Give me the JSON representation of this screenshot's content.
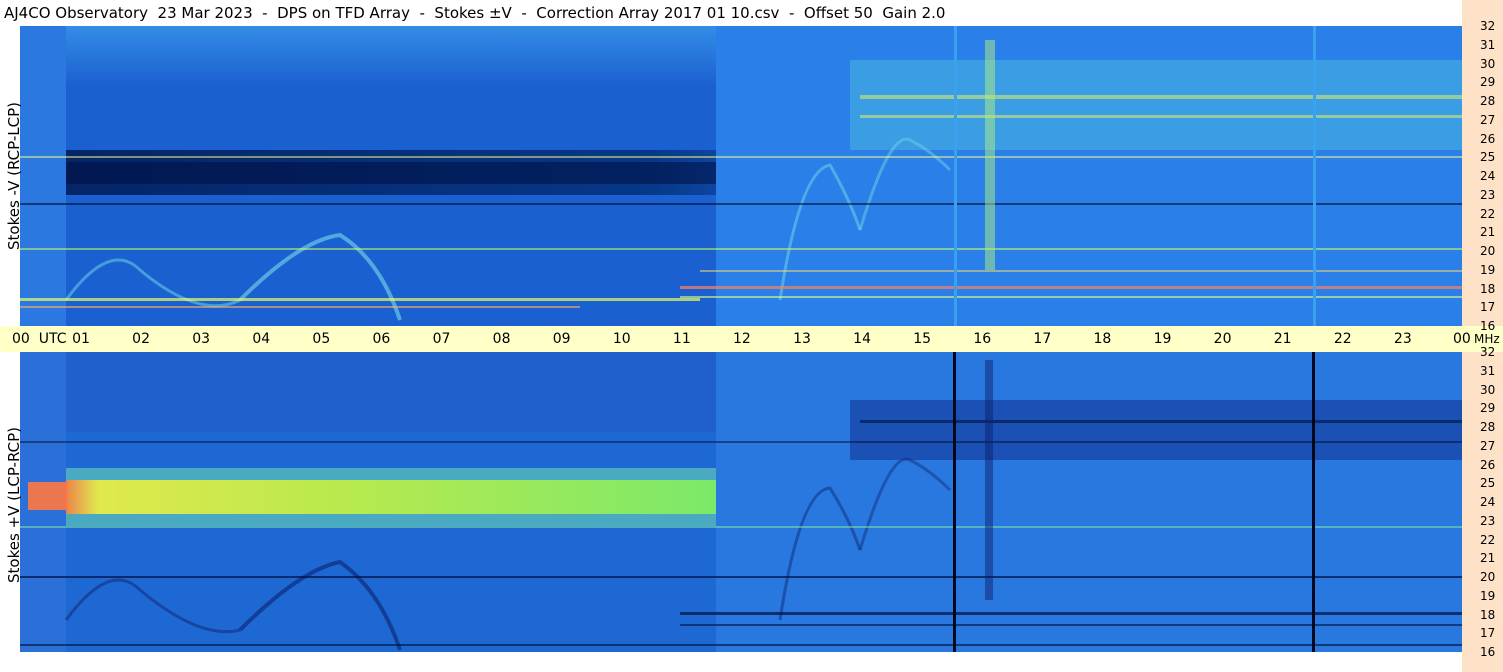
{
  "title": "AJ4CO Observatory  23 Mar 2023  -  DPS on TFD Array  -  Stokes ±V  -  Correction Array 2017 01 10.csv  -  Offset 50  Gain 2.0",
  "panels": [
    {
      "id": "stokes-minus-v",
      "ylabel": "Stokes -V (RCP-LCP)"
    },
    {
      "id": "stokes-plus-v",
      "ylabel": "Stokes +V (LCP-RCP)"
    }
  ],
  "time_axis": {
    "first_label": "00  UTC",
    "labels": [
      "01",
      "02",
      "03",
      "04",
      "05",
      "06",
      "07",
      "08",
      "09",
      "10",
      "11",
      "12",
      "13",
      "14",
      "15",
      "16",
      "17",
      "18",
      "19",
      "20",
      "21",
      "22",
      "23"
    ],
    "last_label": "00"
  },
  "freq_axis": {
    "unit": "MHz",
    "labels": [
      "32",
      "31",
      "30",
      "29",
      "28",
      "27",
      "26",
      "25",
      "24",
      "23",
      "22",
      "21",
      "20",
      "19",
      "18",
      "17",
      "16"
    ]
  },
  "colors": {
    "right_strip": "#fde2c8",
    "time_axis_bg": "#ffffc8",
    "spectrogram_base": "#1a60d0"
  },
  "chart_data": {
    "type": "heatmap",
    "title": "AJ4CO Observatory  23 Mar 2023  -  DPS on TFD Array  -  Stokes ±V  -  Correction Array 2017 01 10.csv  -  Offset 50  Gain 2.0",
    "x_axis": {
      "quantity": "time",
      "unit": "UTC hour",
      "range": [
        0,
        24
      ],
      "ticks": [
        "00",
        "01",
        "02",
        "03",
        "04",
        "05",
        "06",
        "07",
        "08",
        "09",
        "10",
        "11",
        "12",
        "13",
        "14",
        "15",
        "16",
        "17",
        "18",
        "19",
        "20",
        "21",
        "22",
        "23",
        "00"
      ]
    },
    "y_axis": {
      "unit": "MHz",
      "range": [
        16,
        32
      ],
      "ticks": [
        16,
        17,
        18,
        19,
        20,
        21,
        22,
        23,
        24,
        25,
        26,
        27,
        28,
        29,
        30,
        31,
        32
      ]
    },
    "series": [
      {
        "name": "Stokes -V (RCP-LCP)"
      },
      {
        "name": "Stokes +V (LCP-RCP)"
      }
    ],
    "features": {
      "strong_band_mhz": [
        23.6,
        25.0
      ],
      "strong_band_time_utc": [
        0.8,
        11.6
      ],
      "interference_period_start_utc": 11.6,
      "vertical_lines_utc": [
        15.55,
        21.55
      ]
    }
  }
}
